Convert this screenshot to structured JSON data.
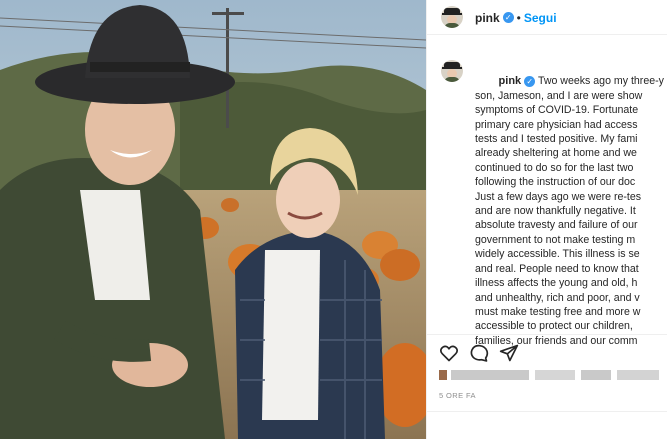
{
  "post": {
    "username": "pink",
    "header_separator": "•",
    "follow_label": "Segui",
    "caption_lines": [
      "Two weeks ago my three-y",
      "son, Jameson, and I are were show",
      "symptoms of COVID-19. Fortunate",
      "primary care physician had access",
      "tests and I tested positive. My fami",
      "already sheltering at home and we",
      "continued to do so for the last two",
      "following the instruction of our doc",
      "Just a few days ago we were re-tes",
      "and are now thankfully negative. It",
      "absolute travesty and failure of our",
      "government to not make testing m",
      "widely accessible. This illness is se",
      "and real. People need to know that",
      "illness affects the young and old, h",
      "and unhealthy, rich and poor, and v",
      "must make testing free and more w",
      "accessible to protect our children,",
      "families, our friends and our comm"
    ],
    "timestamp": "5 ORE FA"
  },
  "icons": {
    "like": "heart-icon",
    "comment": "comment-icon",
    "share": "share-icon",
    "verified": "verified-badge-icon"
  },
  "colors": {
    "accent": "#0095f6",
    "verified": "#3897f0",
    "text": "#262626",
    "muted": "#8e8e8e"
  }
}
